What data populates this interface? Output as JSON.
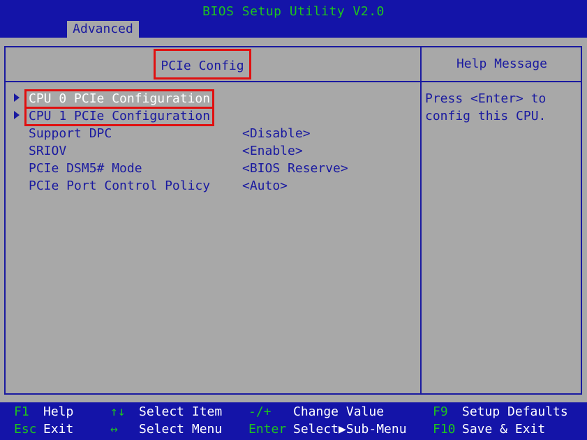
{
  "header": {
    "title": "BIOS Setup Utility V2.0",
    "tab": "Advanced"
  },
  "main": {
    "section_title": "PCIe Config",
    "help_title": "Help Message",
    "submenus": [
      {
        "label": "CPU 0 PCIe Configuration"
      },
      {
        "label": "CPU 1 PCIe Configuration"
      }
    ],
    "settings": [
      {
        "label": "Support DPC",
        "value": "<Disable>"
      },
      {
        "label": "SRIOV",
        "value": "<Enable>"
      },
      {
        "label": "PCIe DSM5# Mode",
        "value": "<BIOS Reserve>"
      },
      {
        "label": "PCIe Port Control Policy",
        "value": "<Auto>"
      }
    ],
    "help_lines": [
      "Press <Enter> to",
      "config this CPU."
    ]
  },
  "footer": {
    "keys": [
      {
        "key": "F1",
        "label": "Help"
      },
      {
        "key": "Esc",
        "label": "Exit"
      },
      {
        "key": "↑↓",
        "label": "Select Item"
      },
      {
        "key": "↔",
        "label": "Select Menu"
      },
      {
        "key": "-/+",
        "label": "Change Value"
      },
      {
        "key": "Enter",
        "label": "Select▶Sub-Menu"
      },
      {
        "key": "F9",
        "label": "Setup Defaults"
      },
      {
        "key": "F10",
        "label": "Save & Exit"
      }
    ]
  },
  "colors": {
    "bar_blue": "#1414a8",
    "panel_gray": "#a8a8a8",
    "text_blue": "#1a1aa0",
    "key_green": "#1ec41e",
    "highlight_red": "#e01010"
  },
  "icons": [
    "submenu-arrow-icon"
  ]
}
